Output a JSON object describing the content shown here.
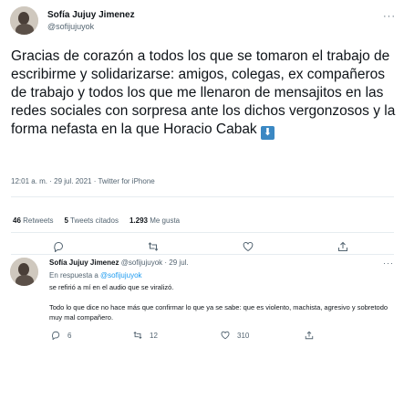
{
  "tweet": {
    "author_name": "Sofía Jujuy Jimenez",
    "author_handle": "@sofijujuyok",
    "text": "Gracias de corazón a todos los que se tomaron el trabajo de escribirme y solidarizarse: amigos, colegas, ex compañeros de trabajo y todos los que me llenaron de mensajitos en las redes sociales con sorpresa ante los dichos vergonzosos y la forma nefasta en la que Horacio Cabak",
    "emoji": "⬇",
    "meta": "12:01 a. m. · 29 jul. 2021 · Twitter for iPhone",
    "more": "···"
  },
  "stats": {
    "retweets_count": "46",
    "retweets_label": "Retweets",
    "quotes_count": "5",
    "quotes_label": "Tweets citados",
    "likes_count": "1.293",
    "likes_label": "Me gusta"
  },
  "reply": {
    "author_name": "Sofía Jujuy Jimenez",
    "author_handle": "@sofijujuyok",
    "date": "· 29 jul.",
    "more": "···",
    "replying_prefix": "En respuesta a",
    "replying_to": "@sofijujuyok",
    "line1": "se refirió a mí en el audio que se viralizó.",
    "body": "Todo lo que dice no hace más que confirmar lo que ya se sabe: que es violento, machista, agresivo y sobretodo muy mal compañero.",
    "replies_count": "6",
    "retweets_count": "12",
    "likes_count": "310"
  },
  "icons": {
    "reply": "reply-icon",
    "retweet": "retweet-icon",
    "like": "heart-icon",
    "share": "share-icon"
  },
  "colors": {
    "link": "#1d9bf0",
    "secondary_text": "#536471",
    "divider": "#e6ecf0"
  }
}
